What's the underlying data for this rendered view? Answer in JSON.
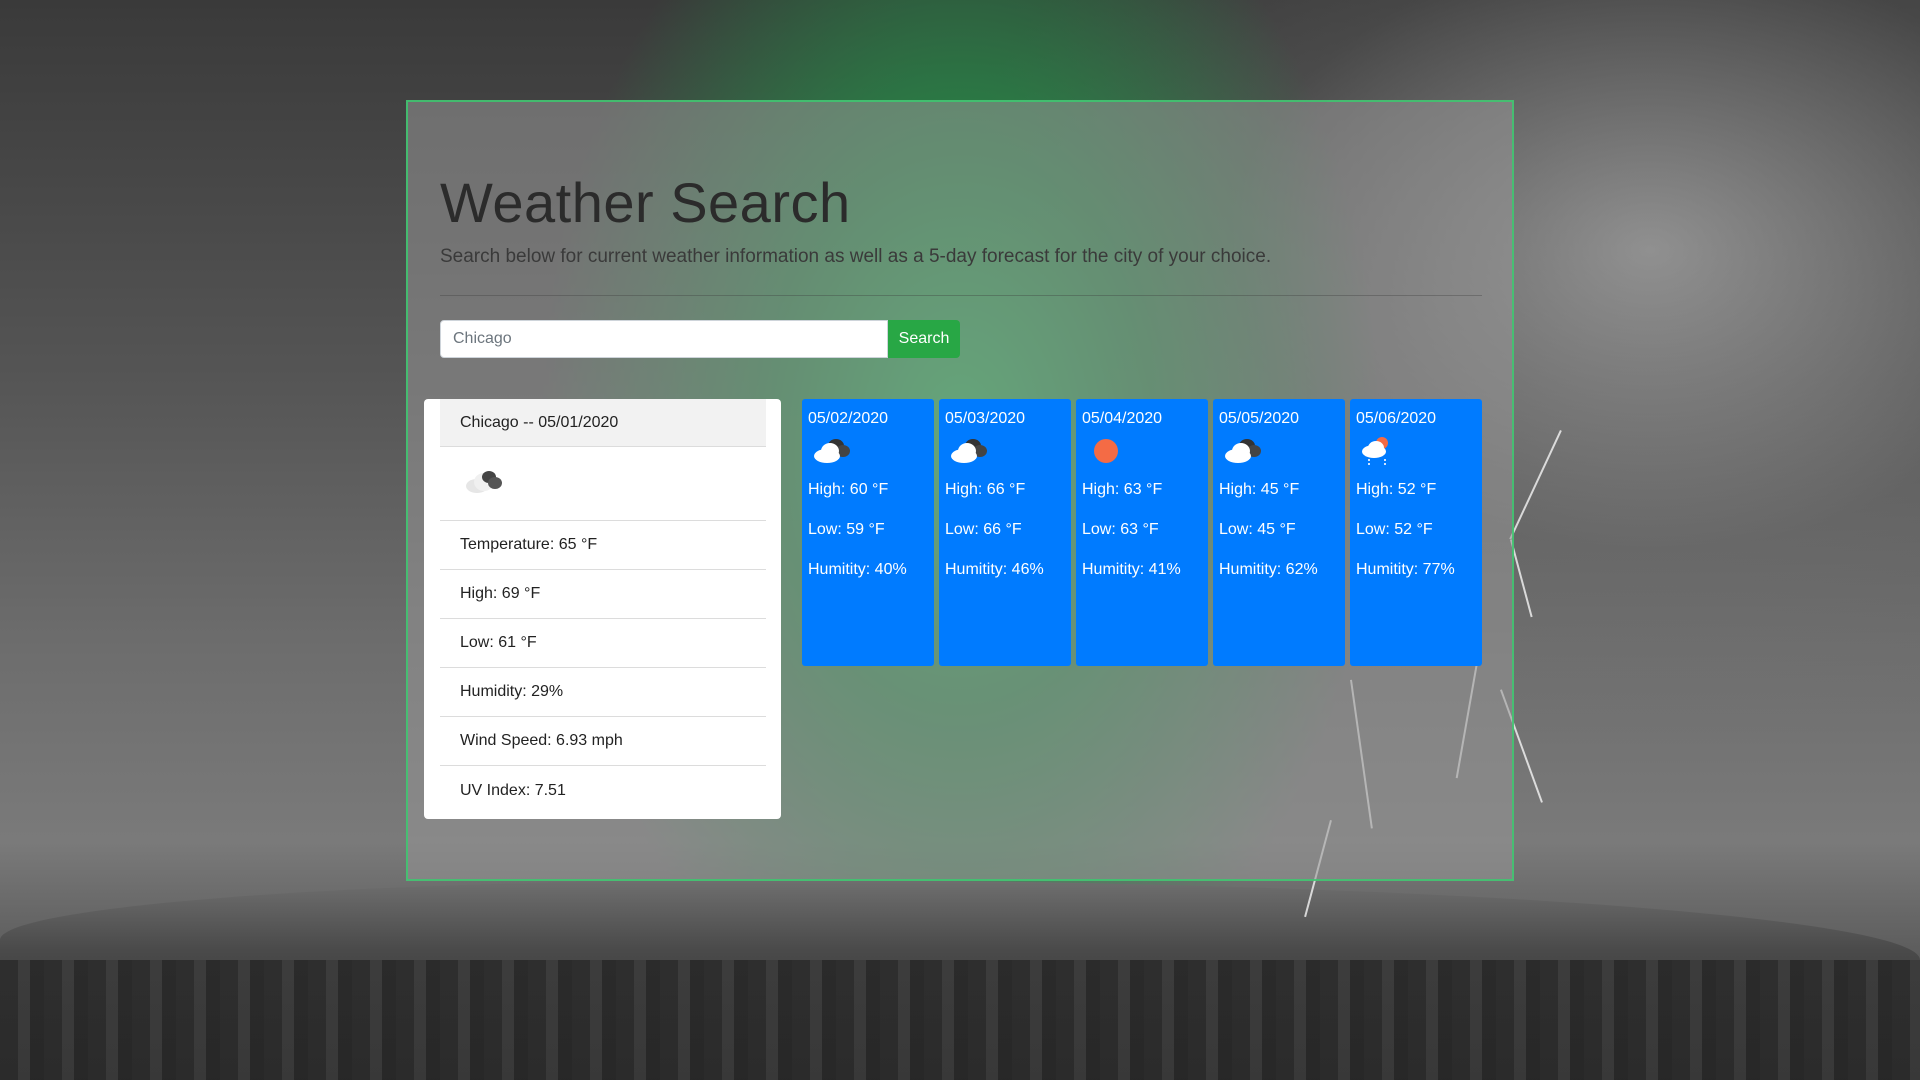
{
  "header": {
    "title": "Weather Search",
    "subtitle": "Search below for current weather information as well as a 5-day forecast for the city of your choice."
  },
  "search": {
    "value": "Chicago",
    "button_label": "Search"
  },
  "current": {
    "heading": "Chicago -- 05/01/2020",
    "icon": "broken-clouds-icon",
    "items": [
      "Temperature: 65 °F",
      "High: 69 °F",
      "Low: 61 °F",
      "Humidity: 29%",
      "Wind Speed: 6.93 mph",
      "UV Index: 7.51"
    ]
  },
  "forecast": [
    {
      "date": "05/02/2020",
      "icon": "broken-clouds-icon",
      "high": "High: 60 °F",
      "low": "Low: 59 °F",
      "humidity": "Humitity: 40%"
    },
    {
      "date": "05/03/2020",
      "icon": "broken-clouds-icon",
      "high": "High: 66 °F",
      "low": "Low: 66 °F",
      "humidity": "Humitity: 46%"
    },
    {
      "date": "05/04/2020",
      "icon": "clear-sky-icon",
      "high": "High: 63 °F",
      "low": "Low: 63 °F",
      "humidity": "Humitity: 41%"
    },
    {
      "date": "05/05/2020",
      "icon": "broken-clouds-icon",
      "high": "High: 45 °F",
      "low": "Low: 45 °F",
      "humidity": "Humitity: 62%"
    },
    {
      "date": "05/06/2020",
      "icon": "rain-icon",
      "high": "High: 52 °F",
      "low": "Low: 52 °F",
      "humidity": "Humitity: 77%"
    }
  ],
  "colors": {
    "forecast_card": "#007bff",
    "search_button": "#28a745",
    "sun": "#f46b45",
    "glow": "#28be5a"
  }
}
